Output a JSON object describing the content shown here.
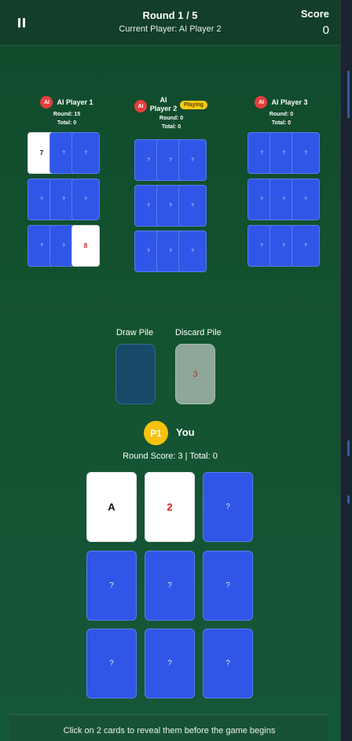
{
  "header": {
    "round_title": "Round 1 / 5",
    "current_player": "Current Player: AI Player 2",
    "score_label": "Score",
    "score_value": "0"
  },
  "opponents": [
    {
      "badge": "AI",
      "name": "AI Player 1",
      "round": "Round: 15",
      "total": "Total: 0",
      "status": "",
      "cards": [
        {
          "label": "7",
          "face": true,
          "red": false
        },
        {
          "label": "?",
          "face": false,
          "red": false
        },
        {
          "label": "?",
          "face": false,
          "red": false
        },
        {
          "label": "?",
          "face": false,
          "red": false
        },
        {
          "label": "?",
          "face": false,
          "red": false
        },
        {
          "label": "?",
          "face": false,
          "red": false
        },
        {
          "label": "?",
          "face": false,
          "red": false
        },
        {
          "label": "?",
          "face": false,
          "red": false
        },
        {
          "label": "8",
          "face": true,
          "red": true
        }
      ]
    },
    {
      "badge": "AI",
      "name_line1": "AI",
      "name_line2": "Player 2",
      "round": "Round: 0",
      "total": "Total: 0",
      "status": "Playing",
      "cards": [
        {
          "label": "?",
          "face": false,
          "red": false
        },
        {
          "label": "?",
          "face": false,
          "red": false
        },
        {
          "label": "?",
          "face": false,
          "red": false
        },
        {
          "label": "?",
          "face": false,
          "red": false
        },
        {
          "label": "?",
          "face": false,
          "red": false
        },
        {
          "label": "?",
          "face": false,
          "red": false
        },
        {
          "label": "?",
          "face": false,
          "red": false
        },
        {
          "label": "?",
          "face": false,
          "red": false
        },
        {
          "label": "?",
          "face": false,
          "red": false
        }
      ]
    },
    {
      "badge": "AI",
      "name": "AI Player 3",
      "round": "Round: 0",
      "total": "Total: 0",
      "status": "",
      "cards": [
        {
          "label": "?",
          "face": false,
          "red": false
        },
        {
          "label": "?",
          "face": false,
          "red": false
        },
        {
          "label": "?",
          "face": false,
          "red": false
        },
        {
          "label": "?",
          "face": false,
          "red": false
        },
        {
          "label": "?",
          "face": false,
          "red": false
        },
        {
          "label": "?",
          "face": false,
          "red": false
        },
        {
          "label": "?",
          "face": false,
          "red": false
        },
        {
          "label": "?",
          "face": false,
          "red": false
        },
        {
          "label": "?",
          "face": false,
          "red": false
        }
      ]
    }
  ],
  "piles": {
    "draw_label": "Draw Pile",
    "discard_label": "Discard Pile",
    "discard_value": "3"
  },
  "player": {
    "badge": "P1",
    "name": "You",
    "round_score_text": "Round Score: 3 | Total: 0",
    "cards": [
      {
        "label": "A",
        "face": true,
        "red": false
      },
      {
        "label": "2",
        "face": true,
        "red": true
      },
      {
        "label": "?",
        "face": false,
        "red": false
      },
      {
        "label": "?",
        "face": false,
        "red": false
      },
      {
        "label": "?",
        "face": false,
        "red": false
      },
      {
        "label": "?",
        "face": false,
        "red": false
      },
      {
        "label": "?",
        "face": false,
        "red": false
      },
      {
        "label": "?",
        "face": false,
        "red": false
      },
      {
        "label": "?",
        "face": false,
        "red": false
      }
    ]
  },
  "footer": {
    "hint": "Click on 2 cards to reveal them before the game begins"
  },
  "colors": {
    "card_back": "#2f56e6",
    "ai_badge": "#e53e3e",
    "player_badge": "#f6c20e",
    "red_card_text": "#d32020"
  }
}
